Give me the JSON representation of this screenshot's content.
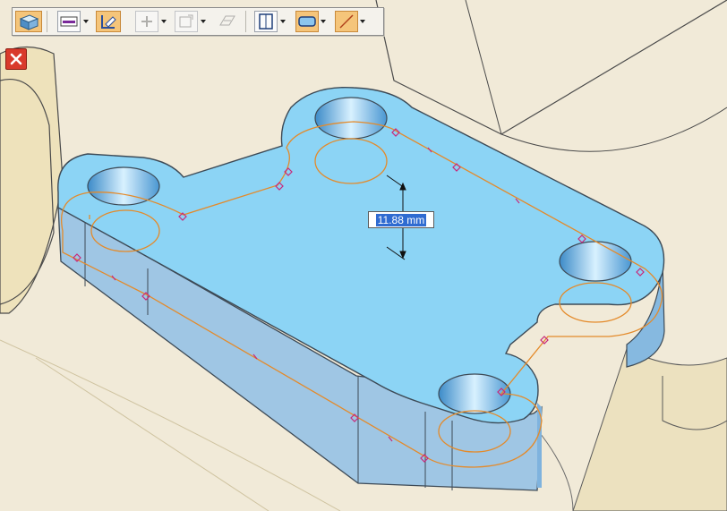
{
  "toolbar": {
    "tools": [
      {
        "id": "part-view",
        "icon": "part-shaded-icon",
        "state": "active"
      },
      {
        "id": "color",
        "icon": "color-swatch-icon",
        "dropdown": true
      },
      {
        "id": "sketch-plane",
        "icon": "sketch-plane-icon",
        "state": "active"
      },
      {
        "id": "add",
        "icon": "plus-icon",
        "dropdown": true,
        "state": "disabled"
      },
      {
        "id": "region",
        "icon": "region-icon",
        "dropdown": true,
        "state": "disabled"
      },
      {
        "id": "plane",
        "icon": "plane-icon",
        "state": "disabled"
      },
      {
        "id": "extent",
        "icon": "extent-icon",
        "dropdown": true
      },
      {
        "id": "profile",
        "icon": "profile-icon",
        "dropdown": true,
        "state": "active"
      },
      {
        "id": "line",
        "icon": "line-icon",
        "dropdown": true,
        "state": "active"
      }
    ]
  },
  "dimension": {
    "value": "11.88 mm"
  },
  "close": {
    "icon": "close-icon"
  },
  "colors": {
    "background": "#f1ead8",
    "part_top": "#8cd4f5",
    "part_side": "#a2c6e2",
    "sketch": "#e48a2a",
    "selection": "#2f6bd1",
    "close": "#d93a2c",
    "toolbar_active": "#f5c57a"
  }
}
